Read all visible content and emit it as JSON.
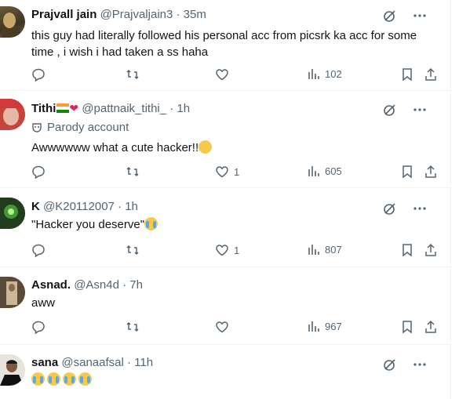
{
  "tweets": [
    {
      "name": "Prajvall jain",
      "handle": "@Prajvaljain3",
      "time": "· 35m",
      "lines": [
        "this guy had  literally followed his personal acc  from picsrk ka acc for some",
        "time , i wish i had taken a ss haha"
      ],
      "likes": "",
      "views": "102"
    },
    {
      "name": "Tithi",
      "handle": "@pattnaik_tithi_",
      "time": "· 1h",
      "parody": "Parody account",
      "text": "Awwwwww what a cute hacker!!",
      "likes": "1",
      "views": "605"
    },
    {
      "name": "K",
      "handle": "@K20112007",
      "time": "· 1h",
      "text": "\"Hacker you deserve\"",
      "likes": "1",
      "views": "807"
    },
    {
      "name": "Asnad.",
      "handle": "@Asn4d",
      "time": "· 7h",
      "text": "aww",
      "likes": "",
      "views": "967"
    },
    {
      "name": "sana",
      "handle": "@sanaafsal",
      "time": "· 11h"
    }
  ],
  "icons": [
    "reply-icon",
    "retweet-icon",
    "like-icon",
    "views-icon",
    "bookmark-icon",
    "share-icon",
    "grok-icon",
    "more-icon"
  ],
  "colors": {
    "text": "#0f1419",
    "secondary": "#536471",
    "divider": "#eff3f4"
  }
}
